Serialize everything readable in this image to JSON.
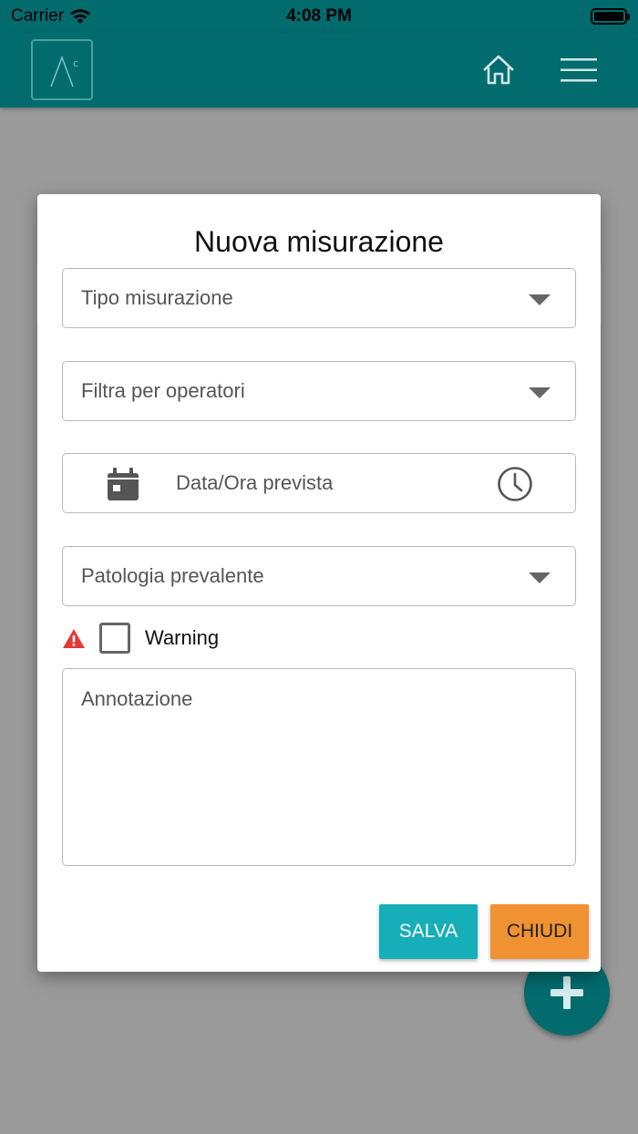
{
  "status_bar": {
    "carrier": "Carrier",
    "time": "4:08 PM"
  },
  "app_bar": {
    "logo_icon": "ac-logo-icon",
    "home_icon": "home-icon",
    "menu_icon": "hamburger-menu-icon",
    "color": "#016b6e"
  },
  "dialog": {
    "title": "Nuova misurazione",
    "tipo_misurazione": {
      "placeholder": "Tipo misurazione"
    },
    "filtra_operatori": {
      "placeholder": "Filtra per operatori"
    },
    "data_ora": {
      "placeholder": "Data/Ora prevista",
      "left_icon": "calendar-icon",
      "right_icon": "clock-icon"
    },
    "patologia": {
      "placeholder": "Patologia prevalente"
    },
    "warning": {
      "label": "Warning",
      "checked": false,
      "icon": "warning-triangle-icon"
    },
    "annotazione": {
      "placeholder": "Annotazione"
    },
    "buttons": {
      "save": "SALVA",
      "close": "CHIUDI"
    }
  },
  "fab": {
    "icon": "plus-icon"
  },
  "colors": {
    "primary": "#016b6e",
    "save": "#16aeb8",
    "close": "#f09232",
    "warning": "#e53935"
  }
}
